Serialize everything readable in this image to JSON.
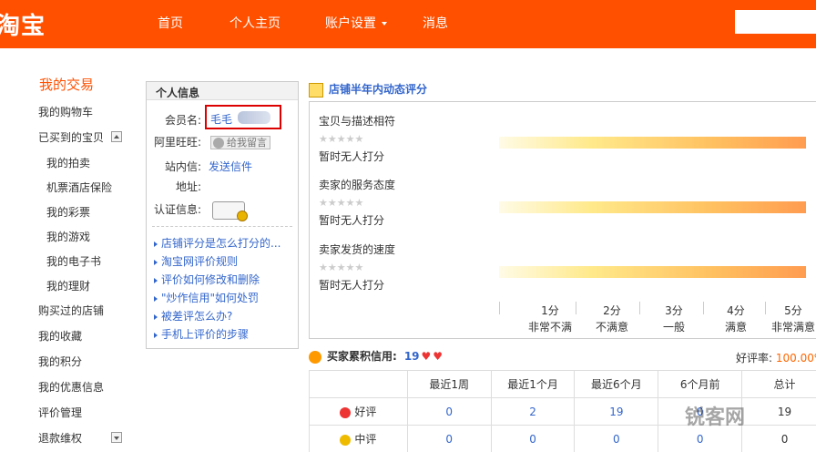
{
  "header": {
    "logo": "淘宝",
    "nav": [
      {
        "label": "首页"
      },
      {
        "label": "个人主页"
      },
      {
        "label": "账户设置"
      },
      {
        "label": "消息"
      }
    ],
    "brand_color": "#ff5000"
  },
  "sidebar": {
    "title": "我的交易",
    "items": [
      {
        "label": "我的购物车"
      },
      {
        "label": "已买到的宝贝"
      },
      {
        "label": "我的拍卖"
      },
      {
        "label": "机票酒店保险"
      },
      {
        "label": "我的彩票"
      },
      {
        "label": "我的游戏"
      },
      {
        "label": "我的电子书"
      },
      {
        "label": "我的理财"
      },
      {
        "label": "购买过的店铺"
      },
      {
        "label": "我的收藏"
      },
      {
        "label": "我的积分"
      },
      {
        "label": "我的优惠信息"
      },
      {
        "label": "评价管理"
      },
      {
        "label": "退款维权"
      }
    ]
  },
  "info": {
    "title": "个人信息",
    "member_label": "会员名:",
    "member_name": "毛毛",
    "wangwang_label": "阿里旺旺:",
    "leave_message": "给我留言",
    "mail_label": "站内信:",
    "mail_link": "发送信件",
    "address_label": "地址:",
    "cert_label": "认证信息:",
    "links": [
      "店铺评分是怎么打分的...",
      "淘宝网评价规则",
      "评价如何修改和删除",
      "\"炒作信用\"如何处罚",
      "被差评怎么办?",
      "手机上评价的步骤"
    ]
  },
  "rating": {
    "title": "店铺半年内动态评分",
    "stars": "★★★★★",
    "items": [
      {
        "label": "宝贝与描述相符",
        "status": "暂时无人打分"
      },
      {
        "label": "卖家的服务态度",
        "status": "暂时无人打分"
      },
      {
        "label": "卖家发货的速度",
        "status": "暂时无人打分"
      }
    ],
    "scale": [
      {
        "score": "1分",
        "desc": "非常不满"
      },
      {
        "score": "2分",
        "desc": "不满意"
      },
      {
        "score": "3分",
        "desc": "一般"
      },
      {
        "score": "4分",
        "desc": "满意"
      },
      {
        "score": "5分",
        "desc": "非常满意"
      }
    ]
  },
  "credit": {
    "title": "买家累积信用:",
    "count": "19",
    "good_rate_label": "好评率:",
    "good_rate_value": "100.00%",
    "columns": [
      "",
      "最近1周",
      "最近1个月",
      "最近6个月",
      "6个月前",
      "总计"
    ],
    "rows": [
      {
        "label": "好评",
        "values": [
          "0",
          "2",
          "19",
          "0",
          "19"
        ]
      },
      {
        "label": "中评",
        "values": [
          "0",
          "0",
          "0",
          "0",
          "0"
        ]
      }
    ]
  },
  "watermark": "锐客网"
}
